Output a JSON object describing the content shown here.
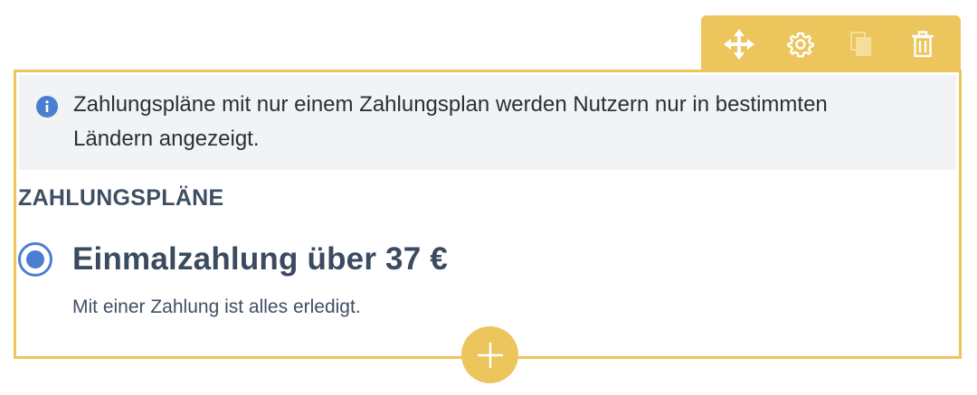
{
  "toolbar": {
    "icons": [
      "move-icon",
      "gear-icon",
      "duplicate-icon",
      "trash-icon"
    ],
    "color": "#ecc55c"
  },
  "notice": {
    "icon": "info-icon",
    "text": "Zahlungspläne mit nur einem Zahlungsplan werden Nutzern nur in bestimmten Ländern angezeigt."
  },
  "section": {
    "title": "ZAHLUNGSPLÄNE"
  },
  "plan": {
    "selected": true,
    "title": "Einmalzahlung über 37 €",
    "description": "Mit einer Zahlung ist alles erledigt."
  },
  "add_button": {
    "icon": "plus-icon"
  },
  "colors": {
    "accent": "#ecc55c",
    "radio": "#4a7fd0",
    "notice_bg": "#f2f3f5",
    "heading": "#3f4f63"
  }
}
